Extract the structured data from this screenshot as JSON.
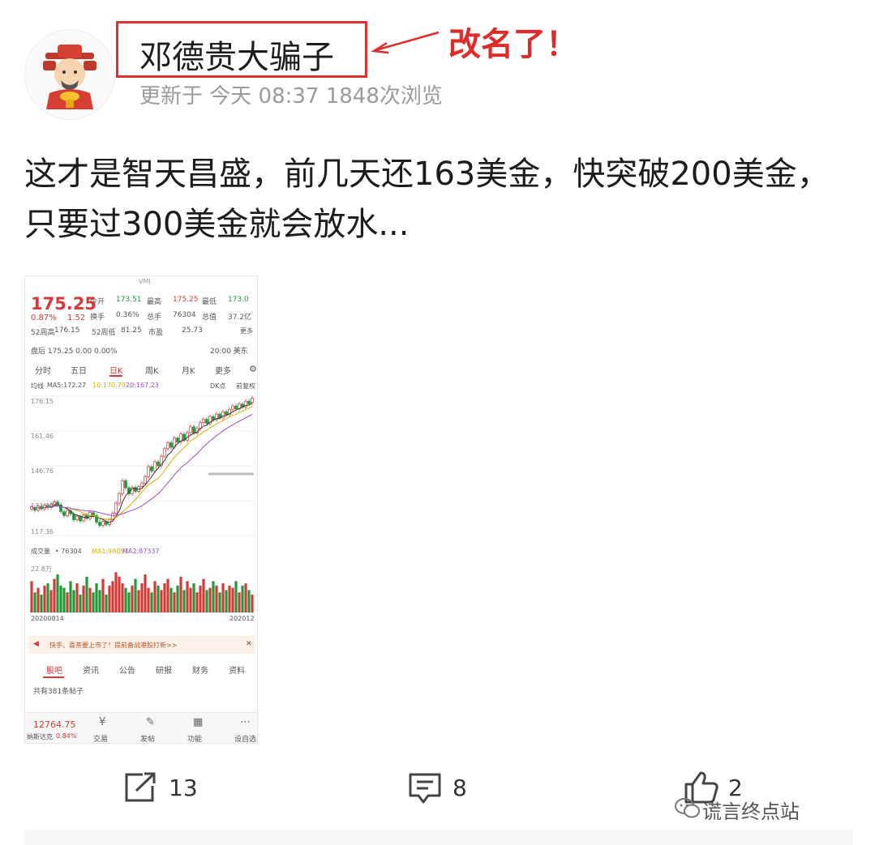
{
  "header": {
    "username": "邓德贵大骗子",
    "annotation": "改名了！",
    "meta": "更新于 今天 08:37   1848次浏览"
  },
  "post": {
    "text": "这才是智天昌盛，前几天还163美金，快突破200美金，只要过300美金就会放水..."
  },
  "stock": {
    "symbol": "VMI",
    "price": "175.25",
    "change_pct": "0.87%",
    "change": "1.52",
    "quote_rows": [
      [
        {
          "t": "今开"
        },
        {
          "t": "173.51",
          "c": "green"
        },
        {
          "t": "最高"
        },
        {
          "t": "175.25",
          "c": "red"
        },
        {
          "t": "最低"
        },
        {
          "t": "173.0",
          "c": "green"
        }
      ],
      [
        {
          "t": "换手"
        },
        {
          "t": "0.36%"
        },
        {
          "t": "总手"
        },
        {
          "t": "76304"
        },
        {
          "t": "总值"
        },
        {
          "t": "37.2亿"
        }
      ]
    ],
    "week52_high_label": "52周高",
    "week52_high": "176.15",
    "week52_low_label": "52周低",
    "week52_low": "81.25",
    "pe_label": "市盈",
    "pe": "25.73",
    "more": "更多",
    "after_hours": "盘后  175.25  0.00  0.00%",
    "after_time": "20:00 美东",
    "period_tabs": [
      "分时",
      "五日",
      "日K",
      "周K",
      "月K",
      "更多"
    ],
    "ma_label": "均线",
    "ma5": "MA5:172.27",
    "ma10": "10:170.79",
    "ma20": "20:167.23",
    "dk": "DK点",
    "fq": "前复权",
    "y_ticks": [
      "176.15",
      "161.46",
      "146.76",
      "132.06",
      "117.36"
    ],
    "vol_label": "成交量",
    "vol_value": "76304",
    "vol_ma1": "MA1:98091",
    "vol_ma2": "MA2:87337",
    "vol_max": "22.8万",
    "date_start": "20200814",
    "date_end": "202012",
    "banner": "快手、喜茶要上市了！提前备战港股打新>>",
    "news_tabs": [
      "股吧",
      "资讯",
      "公告",
      "研报",
      "财务",
      "资料"
    ],
    "posts_count": "共有381条帖子",
    "index_value": "12764.75",
    "index_name": "纳斯达克",
    "index_change": "0.84%",
    "bottom_tabs": [
      "交易",
      "发帖",
      "功能",
      "设自选"
    ],
    "colors": {
      "up": "#d23a3a",
      "down": "#1f9a3a",
      "ma5": "#333333",
      "ma10": "#d4b000",
      "ma20": "#9a4fc0"
    },
    "candles": [
      {
        "o": 128.5,
        "c": 129.5
      },
      {
        "o": 129.2,
        "c": 128.0
      },
      {
        "o": 128.0,
        "c": 129.8
      },
      {
        "o": 129.6,
        "c": 128.6
      },
      {
        "o": 128.6,
        "c": 130.2
      },
      {
        "o": 130.0,
        "c": 129.2
      },
      {
        "o": 129.3,
        "c": 130.6
      },
      {
        "o": 130.5,
        "c": 131.6
      },
      {
        "o": 131.5,
        "c": 130.4
      },
      {
        "o": 130.3,
        "c": 127.5
      },
      {
        "o": 127.4,
        "c": 125.8
      },
      {
        "o": 125.8,
        "c": 127.9
      },
      {
        "o": 127.8,
        "c": 126.5
      },
      {
        "o": 126.4,
        "c": 124.0
      },
      {
        "o": 124.0,
        "c": 125.5
      },
      {
        "o": 125.4,
        "c": 123.5
      },
      {
        "o": 123.6,
        "c": 126.0
      },
      {
        "o": 126.0,
        "c": 124.6
      },
      {
        "o": 124.5,
        "c": 127.2
      },
      {
        "o": 127.0,
        "c": 125.9
      },
      {
        "o": 125.8,
        "c": 123.0
      },
      {
        "o": 123.0,
        "c": 121.6
      },
      {
        "o": 121.6,
        "c": 123.3
      },
      {
        "o": 123.2,
        "c": 122.0
      },
      {
        "o": 122.0,
        "c": 124.0
      },
      {
        "o": 124.0,
        "c": 126.8
      },
      {
        "o": 126.8,
        "c": 131.0
      },
      {
        "o": 131.0,
        "c": 135.0
      },
      {
        "o": 135.0,
        "c": 140.5
      },
      {
        "o": 140.5,
        "c": 137.5
      },
      {
        "o": 137.5,
        "c": 135.0
      },
      {
        "o": 135.0,
        "c": 137.6
      },
      {
        "o": 137.6,
        "c": 136.0
      },
      {
        "o": 136.0,
        "c": 138.0
      },
      {
        "o": 138.0,
        "c": 139.5
      },
      {
        "o": 139.4,
        "c": 142.2
      },
      {
        "o": 142.2,
        "c": 146.4
      },
      {
        "o": 146.4,
        "c": 144.6
      },
      {
        "o": 144.6,
        "c": 148.5
      },
      {
        "o": 148.4,
        "c": 146.8
      },
      {
        "o": 146.8,
        "c": 150.8
      },
      {
        "o": 150.8,
        "c": 154.0
      },
      {
        "o": 154.0,
        "c": 156.5
      },
      {
        "o": 156.5,
        "c": 154.6
      },
      {
        "o": 154.6,
        "c": 158.5
      },
      {
        "o": 158.5,
        "c": 156.8
      },
      {
        "o": 156.8,
        "c": 160.2
      },
      {
        "o": 160.1,
        "c": 157.6
      },
      {
        "o": 157.6,
        "c": 160.8
      },
      {
        "o": 160.8,
        "c": 163.2
      },
      {
        "o": 163.2,
        "c": 160.6
      },
      {
        "o": 160.6,
        "c": 162.6
      },
      {
        "o": 162.5,
        "c": 165.0
      },
      {
        "o": 165.0,
        "c": 166.4
      },
      {
        "o": 166.4,
        "c": 164.6
      },
      {
        "o": 164.6,
        "c": 167.6
      },
      {
        "o": 167.5,
        "c": 166.2
      },
      {
        "o": 166.2,
        "c": 168.6
      },
      {
        "o": 168.6,
        "c": 167.0
      },
      {
        "o": 167.0,
        "c": 169.6
      },
      {
        "o": 169.6,
        "c": 168.4
      },
      {
        "o": 168.4,
        "c": 170.6
      },
      {
        "o": 170.6,
        "c": 172.0
      },
      {
        "o": 172.0,
        "c": 170.8
      },
      {
        "o": 170.8,
        "c": 172.8
      },
      {
        "o": 172.8,
        "c": 171.6
      },
      {
        "o": 171.6,
        "c": 174.0
      },
      {
        "o": 174.0,
        "c": 173.0
      },
      {
        "o": 173.5,
        "c": 175.25
      }
    ],
    "volumes": [
      14,
      9,
      11,
      8,
      12,
      13,
      10,
      15,
      17,
      12,
      11,
      9,
      14,
      10,
      13,
      8,
      12,
      16,
      11,
      9,
      13,
      10,
      15,
      8,
      12,
      14,
      18,
      16,
      13,
      11,
      9,
      12,
      15,
      10,
      13,
      17,
      11,
      9,
      14,
      12,
      10,
      13,
      15,
      11,
      9,
      12,
      16,
      10,
      14,
      11,
      13,
      9,
      12,
      15,
      10,
      11,
      14,
      12,
      9,
      13,
      10,
      12,
      11,
      14,
      9,
      12,
      13,
      10,
      8
    ],
    "volume_max": 22.8
  },
  "actions": [
    {
      "name": "share",
      "count": "13"
    },
    {
      "name": "comment",
      "count": "8"
    },
    {
      "name": "like",
      "count": "2"
    }
  ],
  "watermark": "谎言终点站"
}
